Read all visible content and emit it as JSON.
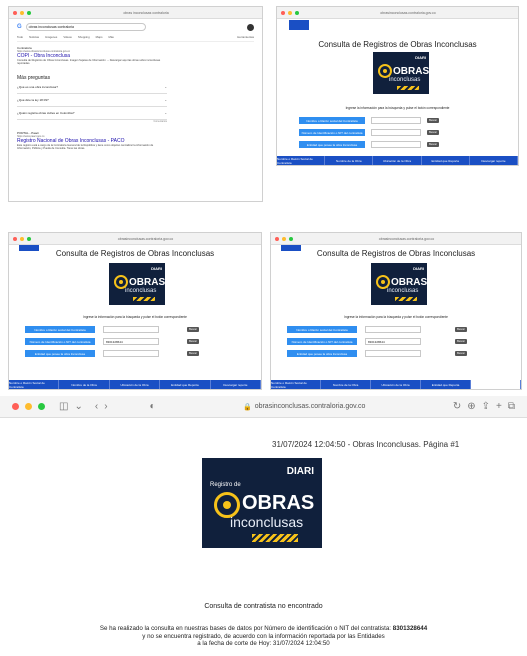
{
  "search": {
    "query": "obras inconclusas contraloria",
    "tabs": [
      "Todo",
      "Noticias",
      "Imágenes",
      "Videos",
      "Shopping",
      "Maps",
      "Más",
      "Todo"
    ],
    "tools": "Herramientas",
    "r1_site": "Contraloria",
    "r1_url": "https://www.obrasinconclusas.contraloria.gov.co",
    "r1_title": "COPI - Obra Inconclusa",
    "r1_desc": "Consulta de Registros de Obras Inconclusas. Imagen Sujetas de Información → Descargar aquí las obras sobre inconclusas reportadas.",
    "paa": "Más preguntas",
    "q1": "¿Qué es una obra inconclusa?",
    "q2": "¿Qué dice la ley 18 09?",
    "q3": "¿Quién registra obras civiles en Colombia?",
    "feedback": "Comentarios",
    "r2_site": "PORTAL - Paaci",
    "r2_url": "https://www.paaci.gov.co",
    "r2_title": "Registro Nacional de Obras Inconclusas - PACO",
    "r2_desc": "Este registro está a cargo de la Contraloría General de la República y tiene como objetivo centralizar la información de Información, Pública y Pueda de Consulta. Tiene las obras."
  },
  "site": {
    "url": "obrasinconclusas.contraloria.gov.co",
    "title": "Consulta de Registros de Obras Inconclusas",
    "logo": {
      "top": "DIARI",
      "reg": "Registro de",
      "obras": "OBRAS",
      "inc": "inconclusas"
    },
    "instr": "Ingrese la información para la búsqueda y pulse el botón correspondiente",
    "btn1": "Nombre o Razón social del Contratista",
    "btn2": "Número de Identificación o NIT del contratista",
    "btn3": "Entidad que posee la obra Inconclusa",
    "search": "Buscar",
    "nit_value": "8301328644",
    "nav": [
      "Nombre o Razón Social de Contratista",
      "Nombre de la Obra",
      "Ubicación de la Obra",
      "Entidad que Reporta",
      "Descargar reporte"
    ],
    "nav4_alt": "Registro contratista no encontrado"
  },
  "result": {
    "url": "obrasinconclusas.contraloria.gov.co",
    "header": "31/07/2024 12:04:50 - Obras Inconclusas. Página #1",
    "notfound": "Consulta de contratista no encontrado",
    "msg1a": "Se ha realizado la consulta en nuestras bases de datos por Número de identificación o NIT del contratista: ",
    "msg1b": "8301328644",
    "msg2": "y no se encuentra registrado, de acuerdo con la información reportada por las Entidades",
    "msg3": "a la fecha de corte de Hoy: 31/07/2024 12:04:50"
  },
  "colors": {
    "accent": "#2f8ef0",
    "nav": "#1a4fc4",
    "logo_bg": "#10203c",
    "logo_yellow": "#f6c21a"
  }
}
